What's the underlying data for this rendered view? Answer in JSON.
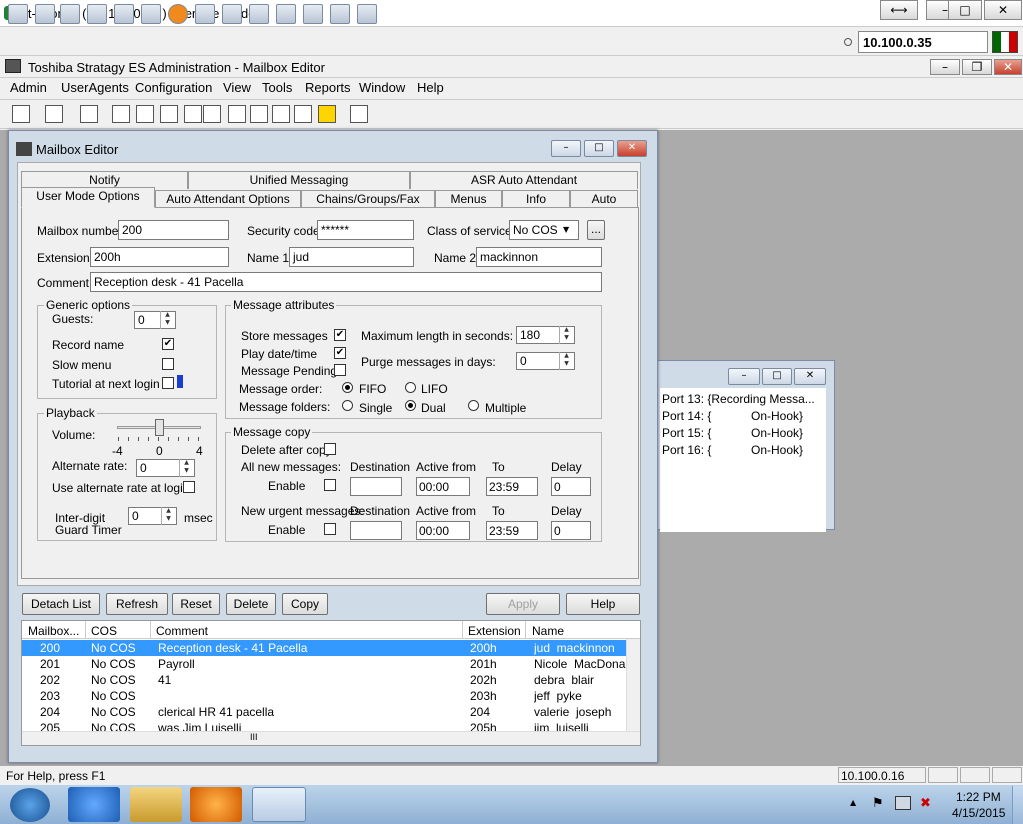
{
  "outer_window": {
    "title": "it-phones ( 10.100.0.35 ) - service mode",
    "ip": "10.100.0.35"
  },
  "app": {
    "title": "Toshiba Stratagy ES Administration - Mailbox Editor"
  },
  "menu": [
    "Admin",
    "UserAgents",
    "Configuration",
    "View",
    "Tools",
    "Reports",
    "Window",
    "Help"
  ],
  "editor": {
    "title": "Mailbox Editor",
    "tabs_back": [
      "Notify",
      "Unified Messaging",
      "ASR Auto Attendant"
    ],
    "tabs_front": [
      "User Mode Options",
      "Auto Attendant Options",
      "Chains/Groups/Fax",
      "Menus",
      "Info",
      "Auto"
    ],
    "fields": {
      "mailbox_number_label": "Mailbox number:",
      "mailbox_number": "200",
      "security_code_label": "Security code:",
      "security_code": "******",
      "cos_label": "Class of service:",
      "cos": "No COS",
      "cos_more": "...",
      "extension_label": "Extension:",
      "extension": "200h",
      "name1_label": "Name 1:",
      "name1": "jud",
      "name2_label": "Name 2:",
      "name2": "mackinnon",
      "comment_label": "Comment:",
      "comment": "Reception desk - 41 Pacella"
    },
    "generic": {
      "title": "Generic options",
      "guests_label": "Guests:",
      "guests": "0",
      "record_name": "Record name",
      "slow_menu": "Slow menu",
      "tutorial": "Tutorial at next login"
    },
    "playback": {
      "title": "Playback",
      "volume_label": "Volume:",
      "vol_min": "-4",
      "vol_mid": "0",
      "vol_max": "4",
      "alt_rate_label": "Alternate rate:",
      "alt_rate": "0",
      "alt_rate_login": "Use alternate rate at login",
      "interdigit_label1": "Inter-digit",
      "interdigit_label2": "Guard Timer",
      "interdigit": "0",
      "msec": "msec"
    },
    "attributes": {
      "title": "Message attributes",
      "store": "Store messages",
      "play_date": "Play date/time",
      "pending": "Message Pending",
      "max_len_label": "Maximum length in seconds:",
      "max_len": "180",
      "purge_label": "Purge messages in days:",
      "purge": "0",
      "order_label": "Message order:",
      "fifo": "FIFO",
      "lifo": "LIFO",
      "folders_label": "Message folders:",
      "single": "Single",
      "dual": "Dual",
      "multiple": "Multiple"
    },
    "copy": {
      "title": "Message copy",
      "delete_after": "Delete after copy",
      "all_new": "All new messages:",
      "urgent": "New urgent messages:",
      "destination": "Destination",
      "active_from": "Active from",
      "to": "To",
      "delay": "Delay",
      "enable": "Enable",
      "from1": "00:00",
      "to1": "23:59",
      "delay1": "0",
      "from2": "00:00",
      "to2": "23:59",
      "delay2": "0"
    },
    "buttons": {
      "detach": "Detach List",
      "refresh": "Refresh",
      "reset": "Reset",
      "delete": "Delete",
      "copy": "Copy",
      "apply": "Apply",
      "help": "Help"
    },
    "list": {
      "headers": [
        "Mailbox...",
        "COS",
        "Comment",
        "Extension",
        "Name"
      ],
      "rows": [
        [
          "200",
          "No COS",
          "Reception desk - 41 Pacella",
          "200h",
          "jud  mackinnon"
        ],
        [
          "201",
          "No COS",
          "Payroll",
          "201h",
          "Nicole  MacDona"
        ],
        [
          "202",
          "No COS",
          "41",
          "202h",
          "debra  blair"
        ],
        [
          "203",
          "No COS",
          "",
          "203h",
          "jeff  pyke"
        ],
        [
          "204",
          "No COS",
          "clerical HR 41 pacella",
          "204",
          "valerie  joseph"
        ],
        [
          "205",
          "No COS",
          "was Jim Luiselli",
          "205h",
          "jim  luiselli"
        ]
      ],
      "scroll_grip": "III"
    }
  },
  "ports": [
    {
      "port": "Port 13: {Recording Messa...",
      "state": ""
    },
    {
      "port": "Port 14: {",
      "state": "On-Hook}"
    },
    {
      "port": "Port 15: {",
      "state": "On-Hook}"
    },
    {
      "port": "Port 16: {",
      "state": "On-Hook}"
    }
  ],
  "status": {
    "help": "For Help, press F1",
    "ip": "10.100.0.16"
  },
  "taskbar": {
    "time": "1:22 PM",
    "date": "4/15/2015"
  }
}
